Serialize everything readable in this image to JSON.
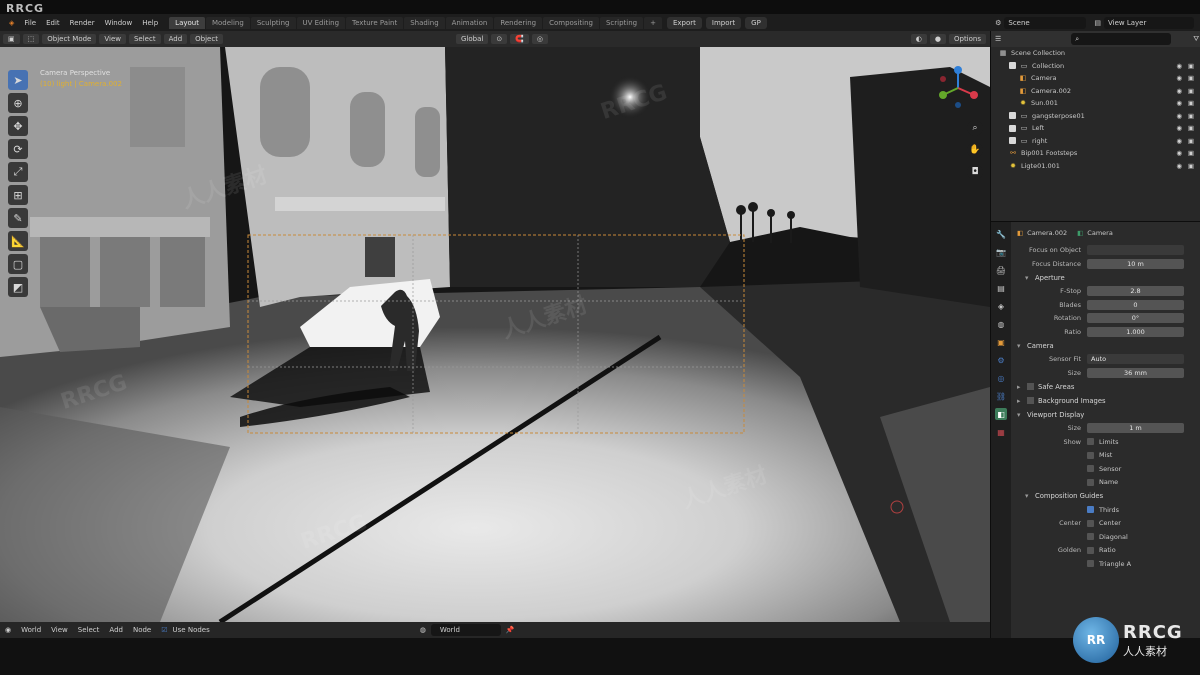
{
  "watermark": {
    "top_left": "RRCG",
    "tiles": [
      "RRCG",
      "人人素材",
      "RRCG",
      "人人素材",
      "RRCG",
      "人人素材"
    ]
  },
  "menu": [
    "File",
    "Edit",
    "Render",
    "Window",
    "Help"
  ],
  "workspace_tabs": [
    "Layout",
    "Modeling",
    "Sculpting",
    "UV Editing",
    "Texture Paint",
    "Shading",
    "Animation",
    "Rendering",
    "Compositing",
    "Scripting"
  ],
  "active_tab": "Layout",
  "top_right": {
    "export": "Export",
    "import": "Import",
    "gp": "GP",
    "scene": "Scene",
    "view_layer": "View Layer"
  },
  "viewport_header": {
    "mode": "Object Mode",
    "view": "View",
    "select": "Select",
    "add": "Add",
    "object": "Object",
    "orientation": "Global",
    "options": "Options"
  },
  "camera_label": {
    "line1": "Camera Perspective",
    "line2": "(10) light | Camera.002"
  },
  "bottom_bar": {
    "world": "World",
    "view": "View",
    "select": "Select",
    "add": "Add",
    "node": "Node",
    "use_nodes": "Use Nodes",
    "world_field": "World"
  },
  "outliner": {
    "title": "Scene Collection",
    "rows": [
      {
        "label": "Collection",
        "indent": 1,
        "icon": "collection-icon"
      },
      {
        "label": "Camera",
        "indent": 2,
        "icon": "camera-icon"
      },
      {
        "label": "Camera.002",
        "indent": 2,
        "icon": "camera-icon"
      },
      {
        "label": "Sun.001",
        "indent": 2,
        "icon": "light-icon"
      },
      {
        "label": "gangsterpose01",
        "indent": 1,
        "icon": "collection-icon"
      },
      {
        "label": "Left",
        "indent": 1,
        "icon": "collection-icon"
      },
      {
        "label": "right",
        "indent": 1,
        "icon": "collection-icon"
      },
      {
        "label": "Bip001 Footsteps",
        "indent": 1,
        "icon": "armature-icon"
      },
      {
        "label": "Ligte01.001",
        "indent": 1,
        "icon": "light-icon"
      }
    ]
  },
  "properties": {
    "object_name": "Camera.002",
    "data_name": "Camera",
    "focus_object_label": "Focus on Object",
    "focus_distance_label": "Focus Distance",
    "focus_distance": "10 m",
    "aperture_section": "Aperture",
    "aperture": [
      {
        "label": "F-Stop",
        "value": "2.8"
      },
      {
        "label": "Blades",
        "value": "0"
      },
      {
        "label": "Rotation",
        "value": "0°"
      },
      {
        "label": "Ratio",
        "value": "1.000"
      }
    ],
    "camera_section": "Camera",
    "sensor_fit_label": "Sensor Fit",
    "sensor_fit": "Auto",
    "size_label": "Size",
    "size": "36 mm",
    "safe_areas": "Safe Areas",
    "background_images": "Background Images",
    "viewport_display": "Viewport Display",
    "vd_size_label": "Size",
    "vd_size": "1 m",
    "show_label": "Show",
    "show_items": [
      "Limits",
      "Mist",
      "Sensor",
      "Name"
    ],
    "composition_guides": "Composition Guides",
    "thirds": "Thirds",
    "center_label": "Center",
    "center_items": [
      "Center",
      "Diagonal"
    ],
    "golden_label": "Golden",
    "golden_items": [
      "Ratio",
      "Triangle A"
    ]
  },
  "logo": {
    "mark": "RR",
    "title": "RRCG",
    "subtitle": "人人素材"
  }
}
